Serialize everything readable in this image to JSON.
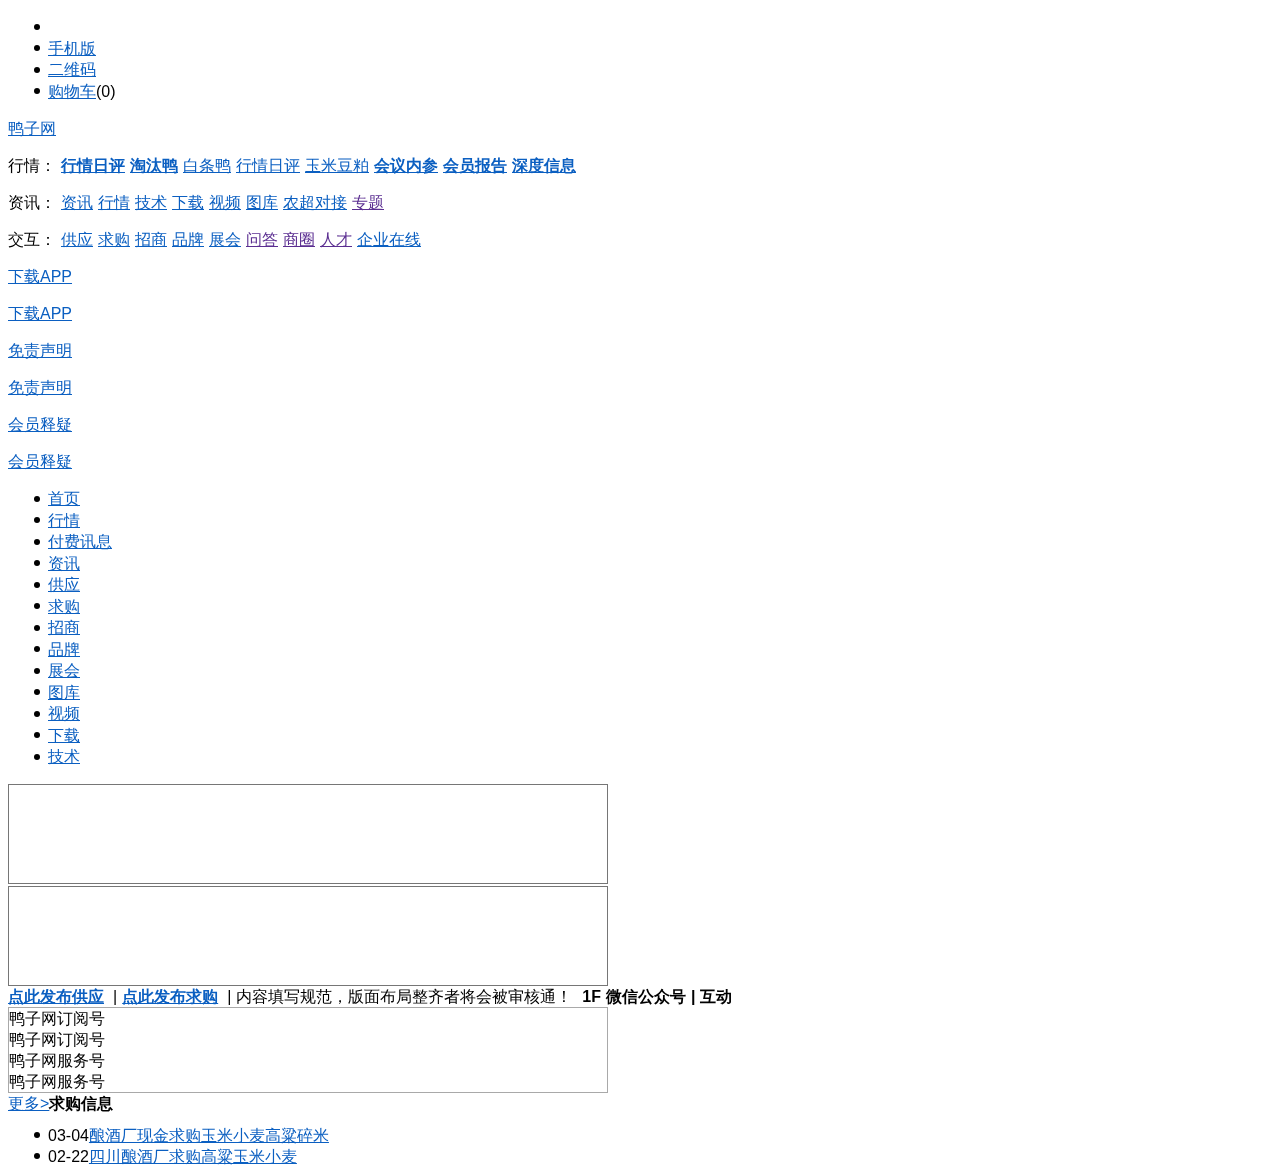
{
  "top_menu": [
    {
      "kind": "blank"
    },
    {
      "kind": "link",
      "label": "手机版"
    },
    {
      "kind": "link",
      "label": "二维码"
    },
    {
      "kind": "link",
      "label": "购物车",
      "count": "(0)"
    }
  ],
  "site_link": "鸭子网",
  "category_rows": [
    {
      "heading": "行情：",
      "links": [
        {
          "label": "行情日评",
          "bold": true,
          "visited": false
        },
        {
          "label": "淘汰鸭",
          "bold": true,
          "visited": false
        },
        {
          "label": "白条鸭",
          "bold": false,
          "visited": false
        },
        {
          "label": "行情日评",
          "bold": false,
          "visited": false
        },
        {
          "label": "玉米豆粕",
          "bold": false,
          "visited": false
        },
        {
          "label": "会议内参",
          "bold": true,
          "visited": false
        },
        {
          "label": "会员报告",
          "bold": true,
          "visited": false
        },
        {
          "label": "深度信息",
          "bold": true,
          "visited": false
        }
      ]
    },
    {
      "heading": "资讯：",
      "links": [
        {
          "label": "资讯",
          "bold": false,
          "visited": false
        },
        {
          "label": "行情",
          "bold": false,
          "visited": false
        },
        {
          "label": "技术",
          "bold": false,
          "visited": false
        },
        {
          "label": "下载",
          "bold": false,
          "visited": false
        },
        {
          "label": "视频",
          "bold": false,
          "visited": false
        },
        {
          "label": "图库",
          "bold": false,
          "visited": false
        },
        {
          "label": "农超对接",
          "bold": false,
          "visited": false
        },
        {
          "label": "专题",
          "bold": false,
          "visited": true
        }
      ]
    },
    {
      "heading": "交互：",
      "links": [
        {
          "label": "供应",
          "bold": false,
          "visited": false
        },
        {
          "label": "求购",
          "bold": false,
          "visited": false
        },
        {
          "label": "招商",
          "bold": false,
          "visited": false
        },
        {
          "label": "品牌",
          "bold": false,
          "visited": false
        },
        {
          "label": "展会",
          "bold": false,
          "visited": false
        },
        {
          "label": "问答",
          "bold": false,
          "visited": true
        },
        {
          "label": "商圈",
          "bold": false,
          "visited": true
        },
        {
          "label": "人才",
          "bold": false,
          "visited": true
        },
        {
          "label": "企业在线",
          "bold": false,
          "visited": false
        }
      ]
    }
  ],
  "page_links": [
    "下载APP",
    "下载APP",
    "免责声明",
    "免责声明",
    "会员释疑",
    "会员释疑"
  ],
  "main_nav": [
    "首页",
    "行情",
    "付费讯息",
    "资讯",
    "供应",
    "求购",
    "招商",
    "品牌",
    "展会",
    "图库",
    "视频",
    "下载",
    "技术"
  ],
  "notice": [
    {
      "kind": "link",
      "text": "点此发布供应"
    },
    {
      "kind": "separator",
      "text": "|"
    },
    {
      "kind": "link",
      "text": "点此发布求购"
    },
    {
      "kind": "separator",
      "text": "|"
    },
    {
      "kind": "text",
      "text": "内容填写规范，版面布局整齐者将会被审核通！"
    },
    {
      "kind": "heading",
      "text": "1F"
    },
    {
      "kind": "heading",
      "text": "微信公众号"
    },
    {
      "kind": "heading_separator",
      "text": "|"
    },
    {
      "kind": "heading",
      "text": "互动"
    }
  ],
  "accounts": [
    "鸭子网订阅号",
    "鸭子网订阅号",
    "鸭子网服务号",
    "鸭子网服务号"
  ],
  "more_link": "更多>",
  "section_title": "求购信息",
  "purchase_list": [
    {
      "date": "03-04",
      "title": "酿酒厂现金求购玉米小麦高粱碎米"
    },
    {
      "date": "02-22",
      "title": "四川酿酒厂求购高粱玉米小麦"
    }
  ]
}
